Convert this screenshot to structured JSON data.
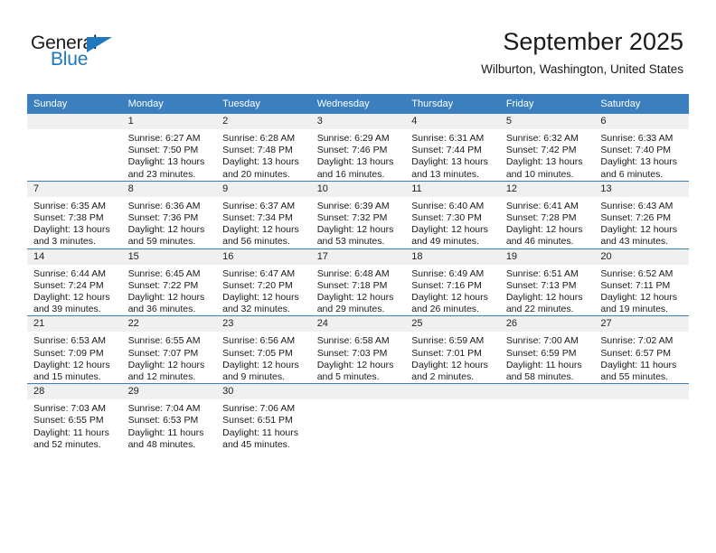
{
  "brand": {
    "name_part1": "General",
    "name_part2": "Blue",
    "accent_color": "#1f77bd"
  },
  "header": {
    "title": "September 2025",
    "location": "Wilburton, Washington, United States"
  },
  "calendar": {
    "header_bg": "#3b7fbf",
    "daynum_bg": "#f0f0f0",
    "weekdays": [
      "Sunday",
      "Monday",
      "Tuesday",
      "Wednesday",
      "Thursday",
      "Friday",
      "Saturday"
    ],
    "labels": {
      "sunrise": "Sunrise:",
      "sunset": "Sunset:",
      "daylight": "Daylight:"
    },
    "weeks": [
      [
        {
          "day": "",
          "sunrise": "",
          "sunset": "",
          "daylight": "",
          "empty": true
        },
        {
          "day": "1",
          "sunrise": "Sunrise: 6:27 AM",
          "sunset": "Sunset: 7:50 PM",
          "daylight": "Daylight: 13 hours and 23 minutes."
        },
        {
          "day": "2",
          "sunrise": "Sunrise: 6:28 AM",
          "sunset": "Sunset: 7:48 PM",
          "daylight": "Daylight: 13 hours and 20 minutes."
        },
        {
          "day": "3",
          "sunrise": "Sunrise: 6:29 AM",
          "sunset": "Sunset: 7:46 PM",
          "daylight": "Daylight: 13 hours and 16 minutes."
        },
        {
          "day": "4",
          "sunrise": "Sunrise: 6:31 AM",
          "sunset": "Sunset: 7:44 PM",
          "daylight": "Daylight: 13 hours and 13 minutes."
        },
        {
          "day": "5",
          "sunrise": "Sunrise: 6:32 AM",
          "sunset": "Sunset: 7:42 PM",
          "daylight": "Daylight: 13 hours and 10 minutes."
        },
        {
          "day": "6",
          "sunrise": "Sunrise: 6:33 AM",
          "sunset": "Sunset: 7:40 PM",
          "daylight": "Daylight: 13 hours and 6 minutes."
        }
      ],
      [
        {
          "day": "7",
          "sunrise": "Sunrise: 6:35 AM",
          "sunset": "Sunset: 7:38 PM",
          "daylight": "Daylight: 13 hours and 3 minutes."
        },
        {
          "day": "8",
          "sunrise": "Sunrise: 6:36 AM",
          "sunset": "Sunset: 7:36 PM",
          "daylight": "Daylight: 12 hours and 59 minutes."
        },
        {
          "day": "9",
          "sunrise": "Sunrise: 6:37 AM",
          "sunset": "Sunset: 7:34 PM",
          "daylight": "Daylight: 12 hours and 56 minutes."
        },
        {
          "day": "10",
          "sunrise": "Sunrise: 6:39 AM",
          "sunset": "Sunset: 7:32 PM",
          "daylight": "Daylight: 12 hours and 53 minutes."
        },
        {
          "day": "11",
          "sunrise": "Sunrise: 6:40 AM",
          "sunset": "Sunset: 7:30 PM",
          "daylight": "Daylight: 12 hours and 49 minutes."
        },
        {
          "day": "12",
          "sunrise": "Sunrise: 6:41 AM",
          "sunset": "Sunset: 7:28 PM",
          "daylight": "Daylight: 12 hours and 46 minutes."
        },
        {
          "day": "13",
          "sunrise": "Sunrise: 6:43 AM",
          "sunset": "Sunset: 7:26 PM",
          "daylight": "Daylight: 12 hours and 43 minutes."
        }
      ],
      [
        {
          "day": "14",
          "sunrise": "Sunrise: 6:44 AM",
          "sunset": "Sunset: 7:24 PM",
          "daylight": "Daylight: 12 hours and 39 minutes."
        },
        {
          "day": "15",
          "sunrise": "Sunrise: 6:45 AM",
          "sunset": "Sunset: 7:22 PM",
          "daylight": "Daylight: 12 hours and 36 minutes."
        },
        {
          "day": "16",
          "sunrise": "Sunrise: 6:47 AM",
          "sunset": "Sunset: 7:20 PM",
          "daylight": "Daylight: 12 hours and 32 minutes."
        },
        {
          "day": "17",
          "sunrise": "Sunrise: 6:48 AM",
          "sunset": "Sunset: 7:18 PM",
          "daylight": "Daylight: 12 hours and 29 minutes."
        },
        {
          "day": "18",
          "sunrise": "Sunrise: 6:49 AM",
          "sunset": "Sunset: 7:16 PM",
          "daylight": "Daylight: 12 hours and 26 minutes."
        },
        {
          "day": "19",
          "sunrise": "Sunrise: 6:51 AM",
          "sunset": "Sunset: 7:13 PM",
          "daylight": "Daylight: 12 hours and 22 minutes."
        },
        {
          "day": "20",
          "sunrise": "Sunrise: 6:52 AM",
          "sunset": "Sunset: 7:11 PM",
          "daylight": "Daylight: 12 hours and 19 minutes."
        }
      ],
      [
        {
          "day": "21",
          "sunrise": "Sunrise: 6:53 AM",
          "sunset": "Sunset: 7:09 PM",
          "daylight": "Daylight: 12 hours and 15 minutes."
        },
        {
          "day": "22",
          "sunrise": "Sunrise: 6:55 AM",
          "sunset": "Sunset: 7:07 PM",
          "daylight": "Daylight: 12 hours and 12 minutes."
        },
        {
          "day": "23",
          "sunrise": "Sunrise: 6:56 AM",
          "sunset": "Sunset: 7:05 PM",
          "daylight": "Daylight: 12 hours and 9 minutes."
        },
        {
          "day": "24",
          "sunrise": "Sunrise: 6:58 AM",
          "sunset": "Sunset: 7:03 PM",
          "daylight": "Daylight: 12 hours and 5 minutes."
        },
        {
          "day": "25",
          "sunrise": "Sunrise: 6:59 AM",
          "sunset": "Sunset: 7:01 PM",
          "daylight": "Daylight: 12 hours and 2 minutes."
        },
        {
          "day": "26",
          "sunrise": "Sunrise: 7:00 AM",
          "sunset": "Sunset: 6:59 PM",
          "daylight": "Daylight: 11 hours and 58 minutes."
        },
        {
          "day": "27",
          "sunrise": "Sunrise: 7:02 AM",
          "sunset": "Sunset: 6:57 PM",
          "daylight": "Daylight: 11 hours and 55 minutes."
        }
      ],
      [
        {
          "day": "28",
          "sunrise": "Sunrise: 7:03 AM",
          "sunset": "Sunset: 6:55 PM",
          "daylight": "Daylight: 11 hours and 52 minutes."
        },
        {
          "day": "29",
          "sunrise": "Sunrise: 7:04 AM",
          "sunset": "Sunset: 6:53 PM",
          "daylight": "Daylight: 11 hours and 48 minutes."
        },
        {
          "day": "30",
          "sunrise": "Sunrise: 7:06 AM",
          "sunset": "Sunset: 6:51 PM",
          "daylight": "Daylight: 11 hours and 45 minutes."
        },
        {
          "day": "",
          "sunrise": "",
          "sunset": "",
          "daylight": "",
          "empty": true
        },
        {
          "day": "",
          "sunrise": "",
          "sunset": "",
          "daylight": "",
          "empty": true
        },
        {
          "day": "",
          "sunrise": "",
          "sunset": "",
          "daylight": "",
          "empty": true
        },
        {
          "day": "",
          "sunrise": "",
          "sunset": "",
          "daylight": "",
          "empty": true
        }
      ]
    ]
  }
}
